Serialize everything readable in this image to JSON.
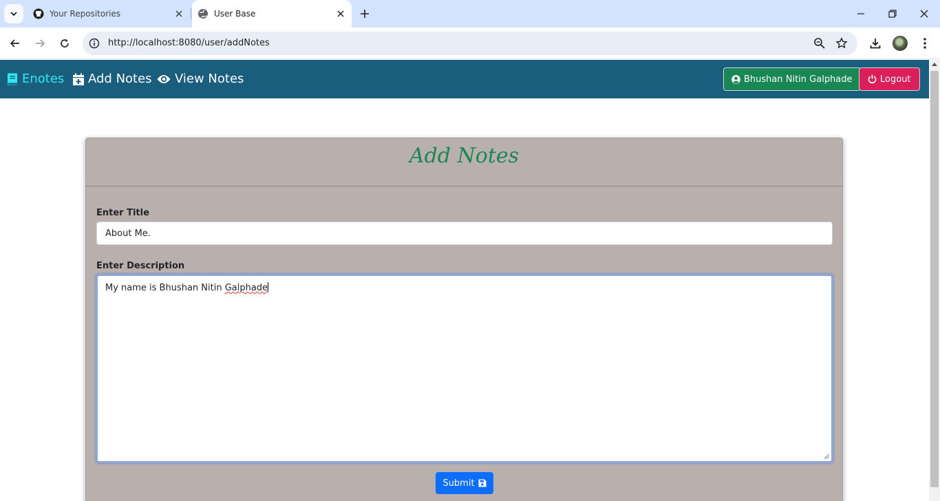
{
  "browser": {
    "tabs": [
      {
        "title": "Your Repositories",
        "icon": "github-icon"
      },
      {
        "title": "User Base",
        "icon": "globe-icon",
        "active": true
      }
    ],
    "url": "http://localhost:8080/user/addNotes"
  },
  "navbar": {
    "brand": "Enotes",
    "links": [
      "Add Notes",
      "View Notes"
    ],
    "user_button": "Bhushan Nitin Galphade",
    "logout_button": "Logout",
    "colors": {
      "bar": "#1a5e7e",
      "brand": "#2ee8f0",
      "user": "#198754",
      "logout": "#dc1f5a"
    }
  },
  "form": {
    "heading": "Add Notes",
    "title_label": "Enter Title",
    "title_value": "About Me.",
    "description_label": "Enter Description",
    "description_prefix": "My name is Bhushan Nitin ",
    "description_misspelled": "Galphade",
    "submit_label": "Submit",
    "colors": {
      "card": "#b9afad",
      "heading": "#198754",
      "submit": "#0d6efd"
    }
  }
}
